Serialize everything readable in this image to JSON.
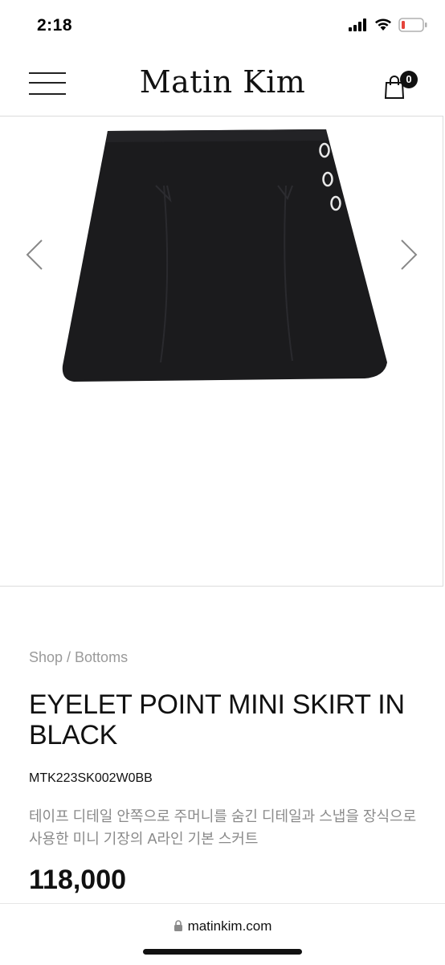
{
  "status_bar": {
    "time": "2:18",
    "battery_color": "#e5443b"
  },
  "header": {
    "brand": "Matin Kim",
    "cart_count": "0"
  },
  "product": {
    "breadcrumb": "Shop / Bottoms",
    "title": "EYELET POINT MINI SKIRT IN BLACK",
    "sku": "MTK223SK002W0BB",
    "description": "테이프 디테일 안쪽으로 주머니를 숨긴 디테일과 스냅을 장식으로 사용한 미니 기장의 A라인 기본 스커트",
    "price": "118,000"
  },
  "browser": {
    "url": "matinkim.com"
  },
  "icons": {
    "menu": "hamburger-menu-icon",
    "cart": "shopping-bag-icon",
    "prev": "chevron-left-icon",
    "next": "chevron-right-icon",
    "lock": "lock-icon"
  }
}
